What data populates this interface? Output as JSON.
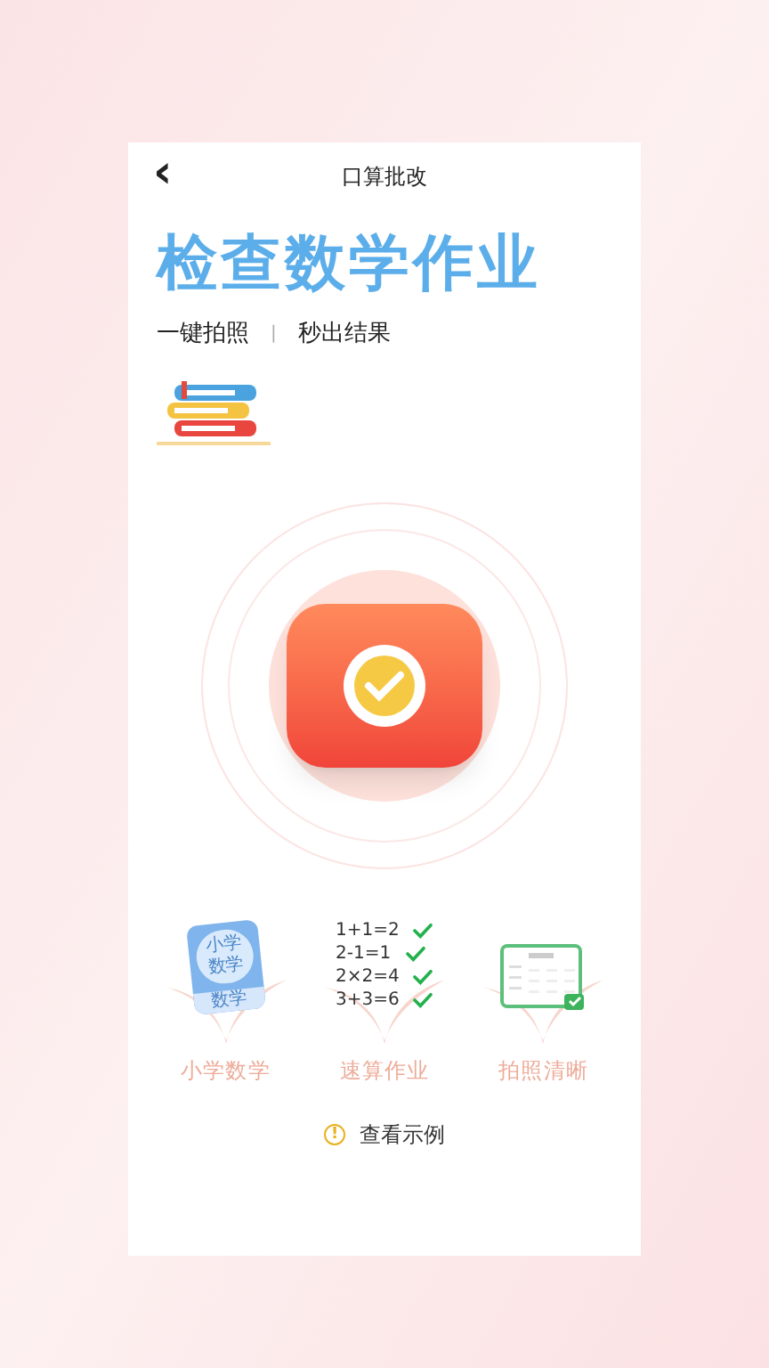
{
  "header": {
    "back": "‹",
    "title": "口算批改"
  },
  "headline": "检查数学作业",
  "subtitle": {
    "left": "一键拍照",
    "separator": "|",
    "right": "秒出结果"
  },
  "features": [
    {
      "kind": "book",
      "label": "小学数学",
      "cover_title": "小学数学",
      "cover_band": "数学"
    },
    {
      "kind": "equations",
      "label": "速算作业",
      "lines": [
        "1+1=2",
        "2-1=1",
        "2×2=4",
        "3+3=6"
      ]
    },
    {
      "kind": "sheet",
      "label": "拍照清晰"
    }
  ],
  "example_link": {
    "icon": "!",
    "label": "查看示例"
  }
}
